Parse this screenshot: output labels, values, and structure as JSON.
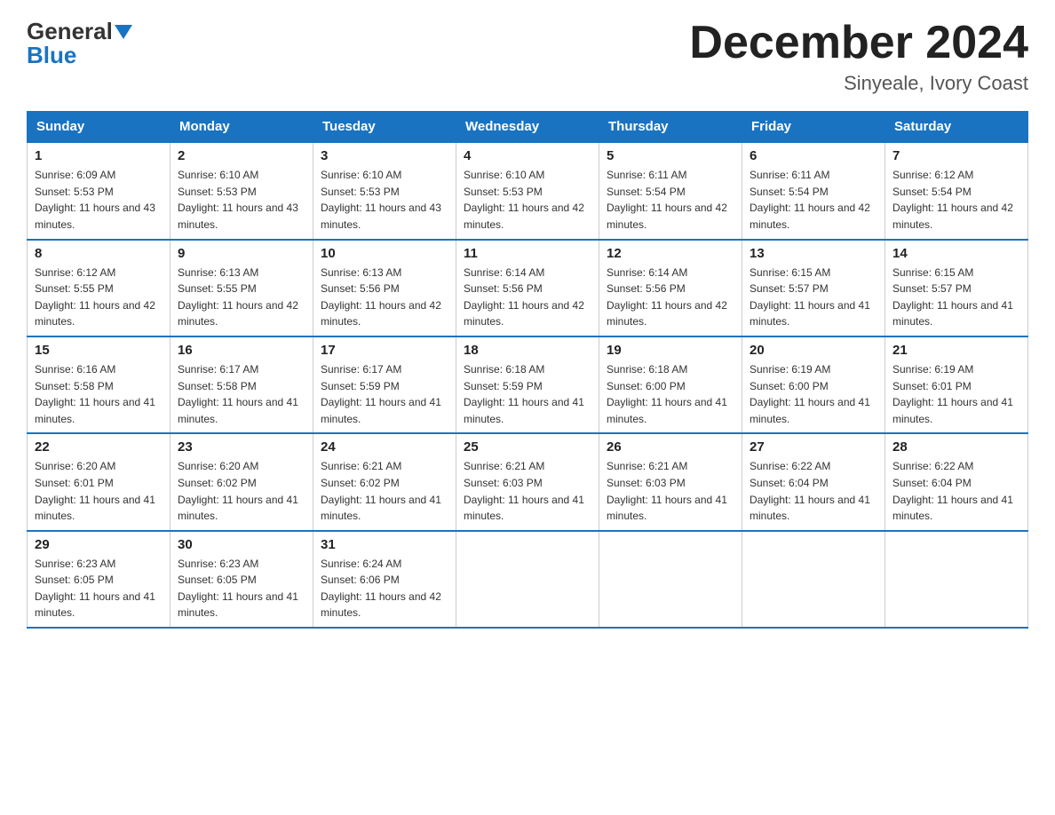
{
  "header": {
    "logo": {
      "general": "General",
      "blue": "Blue"
    },
    "title": "December 2024",
    "subtitle": "Sinyeale, Ivory Coast"
  },
  "days_of_week": [
    "Sunday",
    "Monday",
    "Tuesday",
    "Wednesday",
    "Thursday",
    "Friday",
    "Saturday"
  ],
  "weeks": [
    [
      {
        "day": 1,
        "sunrise": "6:09 AM",
        "sunset": "5:53 PM",
        "daylight": "11 hours and 43 minutes."
      },
      {
        "day": 2,
        "sunrise": "6:10 AM",
        "sunset": "5:53 PM",
        "daylight": "11 hours and 43 minutes."
      },
      {
        "day": 3,
        "sunrise": "6:10 AM",
        "sunset": "5:53 PM",
        "daylight": "11 hours and 43 minutes."
      },
      {
        "day": 4,
        "sunrise": "6:10 AM",
        "sunset": "5:53 PM",
        "daylight": "11 hours and 42 minutes."
      },
      {
        "day": 5,
        "sunrise": "6:11 AM",
        "sunset": "5:54 PM",
        "daylight": "11 hours and 42 minutes."
      },
      {
        "day": 6,
        "sunrise": "6:11 AM",
        "sunset": "5:54 PM",
        "daylight": "11 hours and 42 minutes."
      },
      {
        "day": 7,
        "sunrise": "6:12 AM",
        "sunset": "5:54 PM",
        "daylight": "11 hours and 42 minutes."
      }
    ],
    [
      {
        "day": 8,
        "sunrise": "6:12 AM",
        "sunset": "5:55 PM",
        "daylight": "11 hours and 42 minutes."
      },
      {
        "day": 9,
        "sunrise": "6:13 AM",
        "sunset": "5:55 PM",
        "daylight": "11 hours and 42 minutes."
      },
      {
        "day": 10,
        "sunrise": "6:13 AM",
        "sunset": "5:56 PM",
        "daylight": "11 hours and 42 minutes."
      },
      {
        "day": 11,
        "sunrise": "6:14 AM",
        "sunset": "5:56 PM",
        "daylight": "11 hours and 42 minutes."
      },
      {
        "day": 12,
        "sunrise": "6:14 AM",
        "sunset": "5:56 PM",
        "daylight": "11 hours and 42 minutes."
      },
      {
        "day": 13,
        "sunrise": "6:15 AM",
        "sunset": "5:57 PM",
        "daylight": "11 hours and 41 minutes."
      },
      {
        "day": 14,
        "sunrise": "6:15 AM",
        "sunset": "5:57 PM",
        "daylight": "11 hours and 41 minutes."
      }
    ],
    [
      {
        "day": 15,
        "sunrise": "6:16 AM",
        "sunset": "5:58 PM",
        "daylight": "11 hours and 41 minutes."
      },
      {
        "day": 16,
        "sunrise": "6:17 AM",
        "sunset": "5:58 PM",
        "daylight": "11 hours and 41 minutes."
      },
      {
        "day": 17,
        "sunrise": "6:17 AM",
        "sunset": "5:59 PM",
        "daylight": "11 hours and 41 minutes."
      },
      {
        "day": 18,
        "sunrise": "6:18 AM",
        "sunset": "5:59 PM",
        "daylight": "11 hours and 41 minutes."
      },
      {
        "day": 19,
        "sunrise": "6:18 AM",
        "sunset": "6:00 PM",
        "daylight": "11 hours and 41 minutes."
      },
      {
        "day": 20,
        "sunrise": "6:19 AM",
        "sunset": "6:00 PM",
        "daylight": "11 hours and 41 minutes."
      },
      {
        "day": 21,
        "sunrise": "6:19 AM",
        "sunset": "6:01 PM",
        "daylight": "11 hours and 41 minutes."
      }
    ],
    [
      {
        "day": 22,
        "sunrise": "6:20 AM",
        "sunset": "6:01 PM",
        "daylight": "11 hours and 41 minutes."
      },
      {
        "day": 23,
        "sunrise": "6:20 AM",
        "sunset": "6:02 PM",
        "daylight": "11 hours and 41 minutes."
      },
      {
        "day": 24,
        "sunrise": "6:21 AM",
        "sunset": "6:02 PM",
        "daylight": "11 hours and 41 minutes."
      },
      {
        "day": 25,
        "sunrise": "6:21 AM",
        "sunset": "6:03 PM",
        "daylight": "11 hours and 41 minutes."
      },
      {
        "day": 26,
        "sunrise": "6:21 AM",
        "sunset": "6:03 PM",
        "daylight": "11 hours and 41 minutes."
      },
      {
        "day": 27,
        "sunrise": "6:22 AM",
        "sunset": "6:04 PM",
        "daylight": "11 hours and 41 minutes."
      },
      {
        "day": 28,
        "sunrise": "6:22 AM",
        "sunset": "6:04 PM",
        "daylight": "11 hours and 41 minutes."
      }
    ],
    [
      {
        "day": 29,
        "sunrise": "6:23 AM",
        "sunset": "6:05 PM",
        "daylight": "11 hours and 41 minutes."
      },
      {
        "day": 30,
        "sunrise": "6:23 AM",
        "sunset": "6:05 PM",
        "daylight": "11 hours and 41 minutes."
      },
      {
        "day": 31,
        "sunrise": "6:24 AM",
        "sunset": "6:06 PM",
        "daylight": "11 hours and 42 minutes."
      },
      null,
      null,
      null,
      null
    ]
  ]
}
